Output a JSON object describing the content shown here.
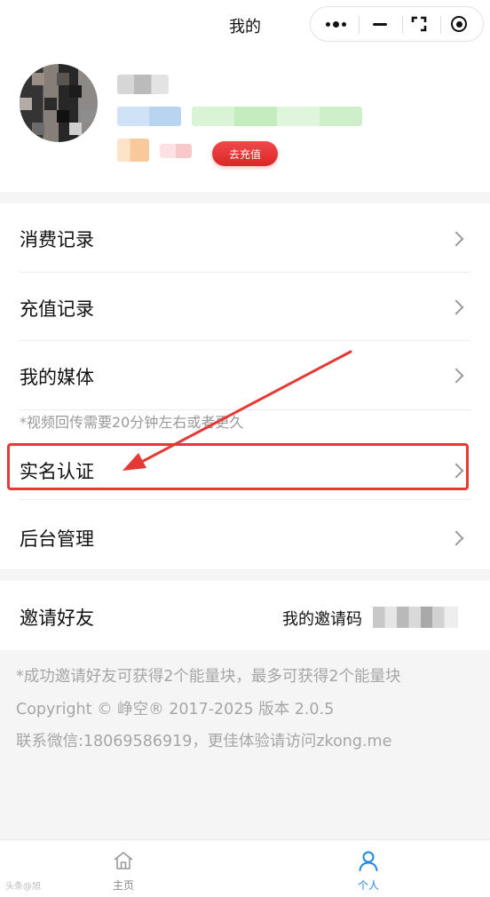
{
  "nav": {
    "title": "我的",
    "capsule_icons": [
      "more-dots-icon",
      "minimize-icon",
      "switch-icon",
      "close-target-icon"
    ]
  },
  "profile": {
    "charge_button": "去充值"
  },
  "menu": {
    "items": [
      {
        "label": "消费记录"
      },
      {
        "label": "充值记录"
      },
      {
        "label": "我的媒体"
      },
      {
        "label": "实名认证"
      },
      {
        "label": "后台管理"
      }
    ],
    "media_note": "*视频回传需要20分钟左右或者更久"
  },
  "invite": {
    "label": "邀请好友",
    "code_label": "我的邀请码"
  },
  "footer": {
    "line1": "*成功邀请好友可获得2个能量块，最多可获得2个能量块",
    "line2": "Copyright © 峥空® 2017-2025 版本 2.0.5",
    "line3": "联系微信:18069586919，更佳体验请访问zkong.me"
  },
  "tabbar": {
    "tabs": [
      {
        "label": "主页",
        "icon": "home-icon",
        "active": false
      },
      {
        "label": "个人",
        "icon": "person-icon",
        "active": true
      }
    ]
  },
  "watermark": "头条@旭",
  "colors": {
    "accent_blue": "#1e88e5",
    "highlight_red": "#e53935",
    "charge_red": "#e33434"
  }
}
